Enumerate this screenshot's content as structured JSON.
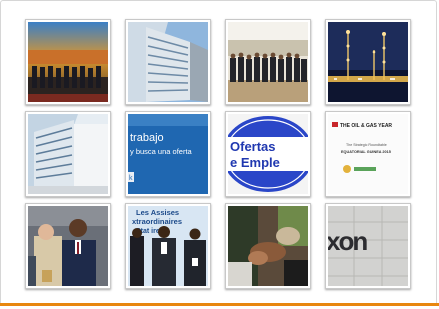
{
  "gallery": {
    "items": [
      {
        "name": "conference-stage-photo"
      },
      {
        "name": "office-building-photo"
      },
      {
        "name": "group-photo-outdoor"
      },
      {
        "name": "refinery-night-photo"
      },
      {
        "name": "office-building-photo-2"
      },
      {
        "name": "job-banner",
        "text1": "trabajo",
        "text2": "y busca una oferta"
      },
      {
        "name": "job-offers-logo",
        "text1": "Ofertas",
        "text2": "e Emple"
      },
      {
        "name": "oil-gas-year-cover",
        "text1": "THE OIL & GAS YEAR",
        "text2": "The Strategic Roundtable",
        "text3": "EQUATORIAL GUINEA 2015"
      },
      {
        "name": "officials-photo"
      },
      {
        "name": "assises-photo",
        "text1": "Les Assises",
        "text2": "xtraordinaires",
        "text3": "Stat ires"
      },
      {
        "name": "handshake-photo"
      },
      {
        "name": "exxon-sign-photo",
        "text1": "xon"
      }
    ]
  }
}
